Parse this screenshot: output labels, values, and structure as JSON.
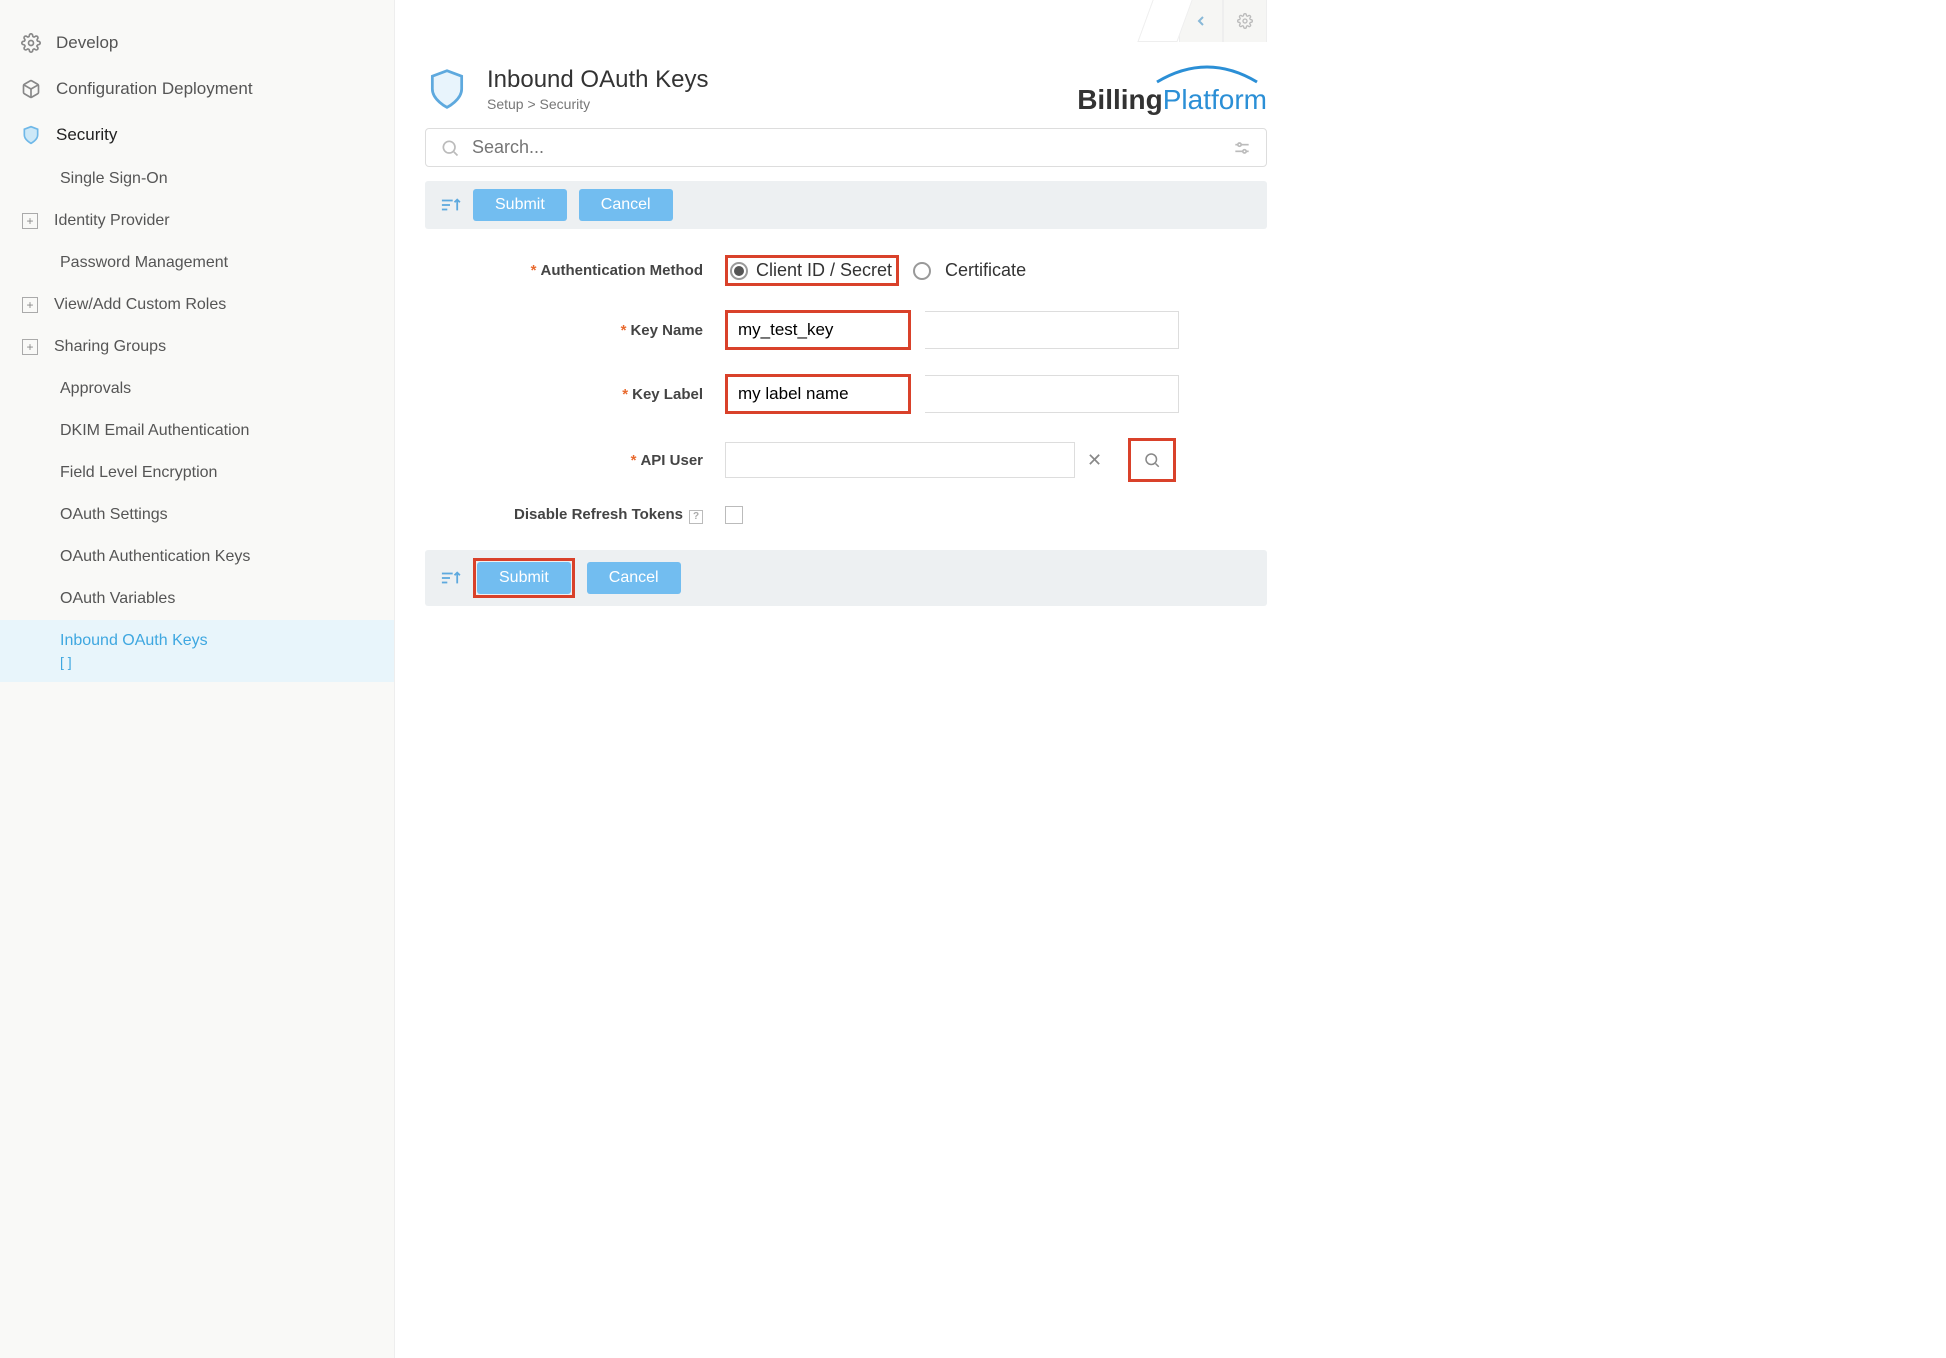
{
  "sidebar": {
    "develop": "Develop",
    "config_deploy": "Configuration Deployment",
    "security": "Security",
    "items": [
      {
        "label": "Single Sign-On",
        "plus": false
      },
      {
        "label": "Identity Provider",
        "plus": true
      },
      {
        "label": "Password Management",
        "plus": false
      },
      {
        "label": "View/Add Custom Roles",
        "plus": true
      },
      {
        "label": "Sharing Groups",
        "plus": true
      },
      {
        "label": "Approvals",
        "plus": false
      },
      {
        "label": "DKIM Email Authentication",
        "plus": false
      },
      {
        "label": "Field Level Encryption",
        "plus": false
      },
      {
        "label": "OAuth Settings",
        "plus": false
      },
      {
        "label": "OAuth Authentication Keys",
        "plus": false
      },
      {
        "label": "OAuth Variables",
        "plus": false
      },
      {
        "label": "Inbound OAuth Keys",
        "plus": false,
        "selected": true,
        "sub": "[ ]"
      }
    ]
  },
  "header": {
    "title": "Inbound OAuth Keys",
    "breadcrumb": "Setup > Security",
    "logo_a": "Billing",
    "logo_b": "Platform"
  },
  "search": {
    "placeholder": "Search..."
  },
  "actions": {
    "submit": "Submit",
    "cancel": "Cancel"
  },
  "form": {
    "auth_method_label": "Authentication Method",
    "auth_opt1": "Client ID / Secret",
    "auth_opt2": "Certificate",
    "key_name_label": "Key Name",
    "key_name_value": "my_test_key",
    "key_label_label": "Key Label",
    "key_label_value": "my label name",
    "api_user_label": "API User",
    "disable_label": "Disable Refresh Tokens"
  }
}
